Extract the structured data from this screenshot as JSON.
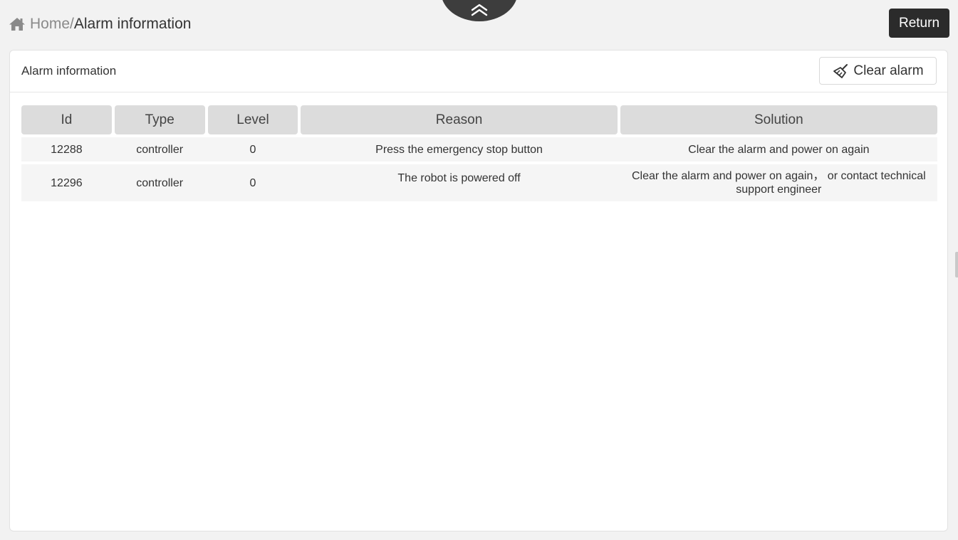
{
  "breadcrumb": {
    "home": "Home",
    "separator": "/",
    "current": "Alarm information"
  },
  "header": {
    "return_label": "Return"
  },
  "panel": {
    "title": "Alarm information",
    "clear_label": "Clear alarm"
  },
  "table": {
    "columns": [
      "Id",
      "Type",
      "Level",
      "Reason",
      "Solution"
    ],
    "rows": [
      {
        "id": "12288",
        "type": "controller",
        "level": "0",
        "reason": "Press the emergency stop button",
        "solution": "Clear the alarm and power on again"
      },
      {
        "id": "12296",
        "type": "controller",
        "level": "0",
        "reason": "The robot is powered off",
        "solution": "Clear the alarm and power on again， or contact technical support engineer"
      }
    ]
  },
  "icons": {
    "home": "home-icon",
    "collapse": "double-chevron-up-icon",
    "clear": "broom-icon"
  },
  "colors": {
    "background": "#f2f2f2",
    "dark_button": "#2b2b2b",
    "header_cell": "#dcdcdc",
    "row": "#f5f5f5"
  }
}
